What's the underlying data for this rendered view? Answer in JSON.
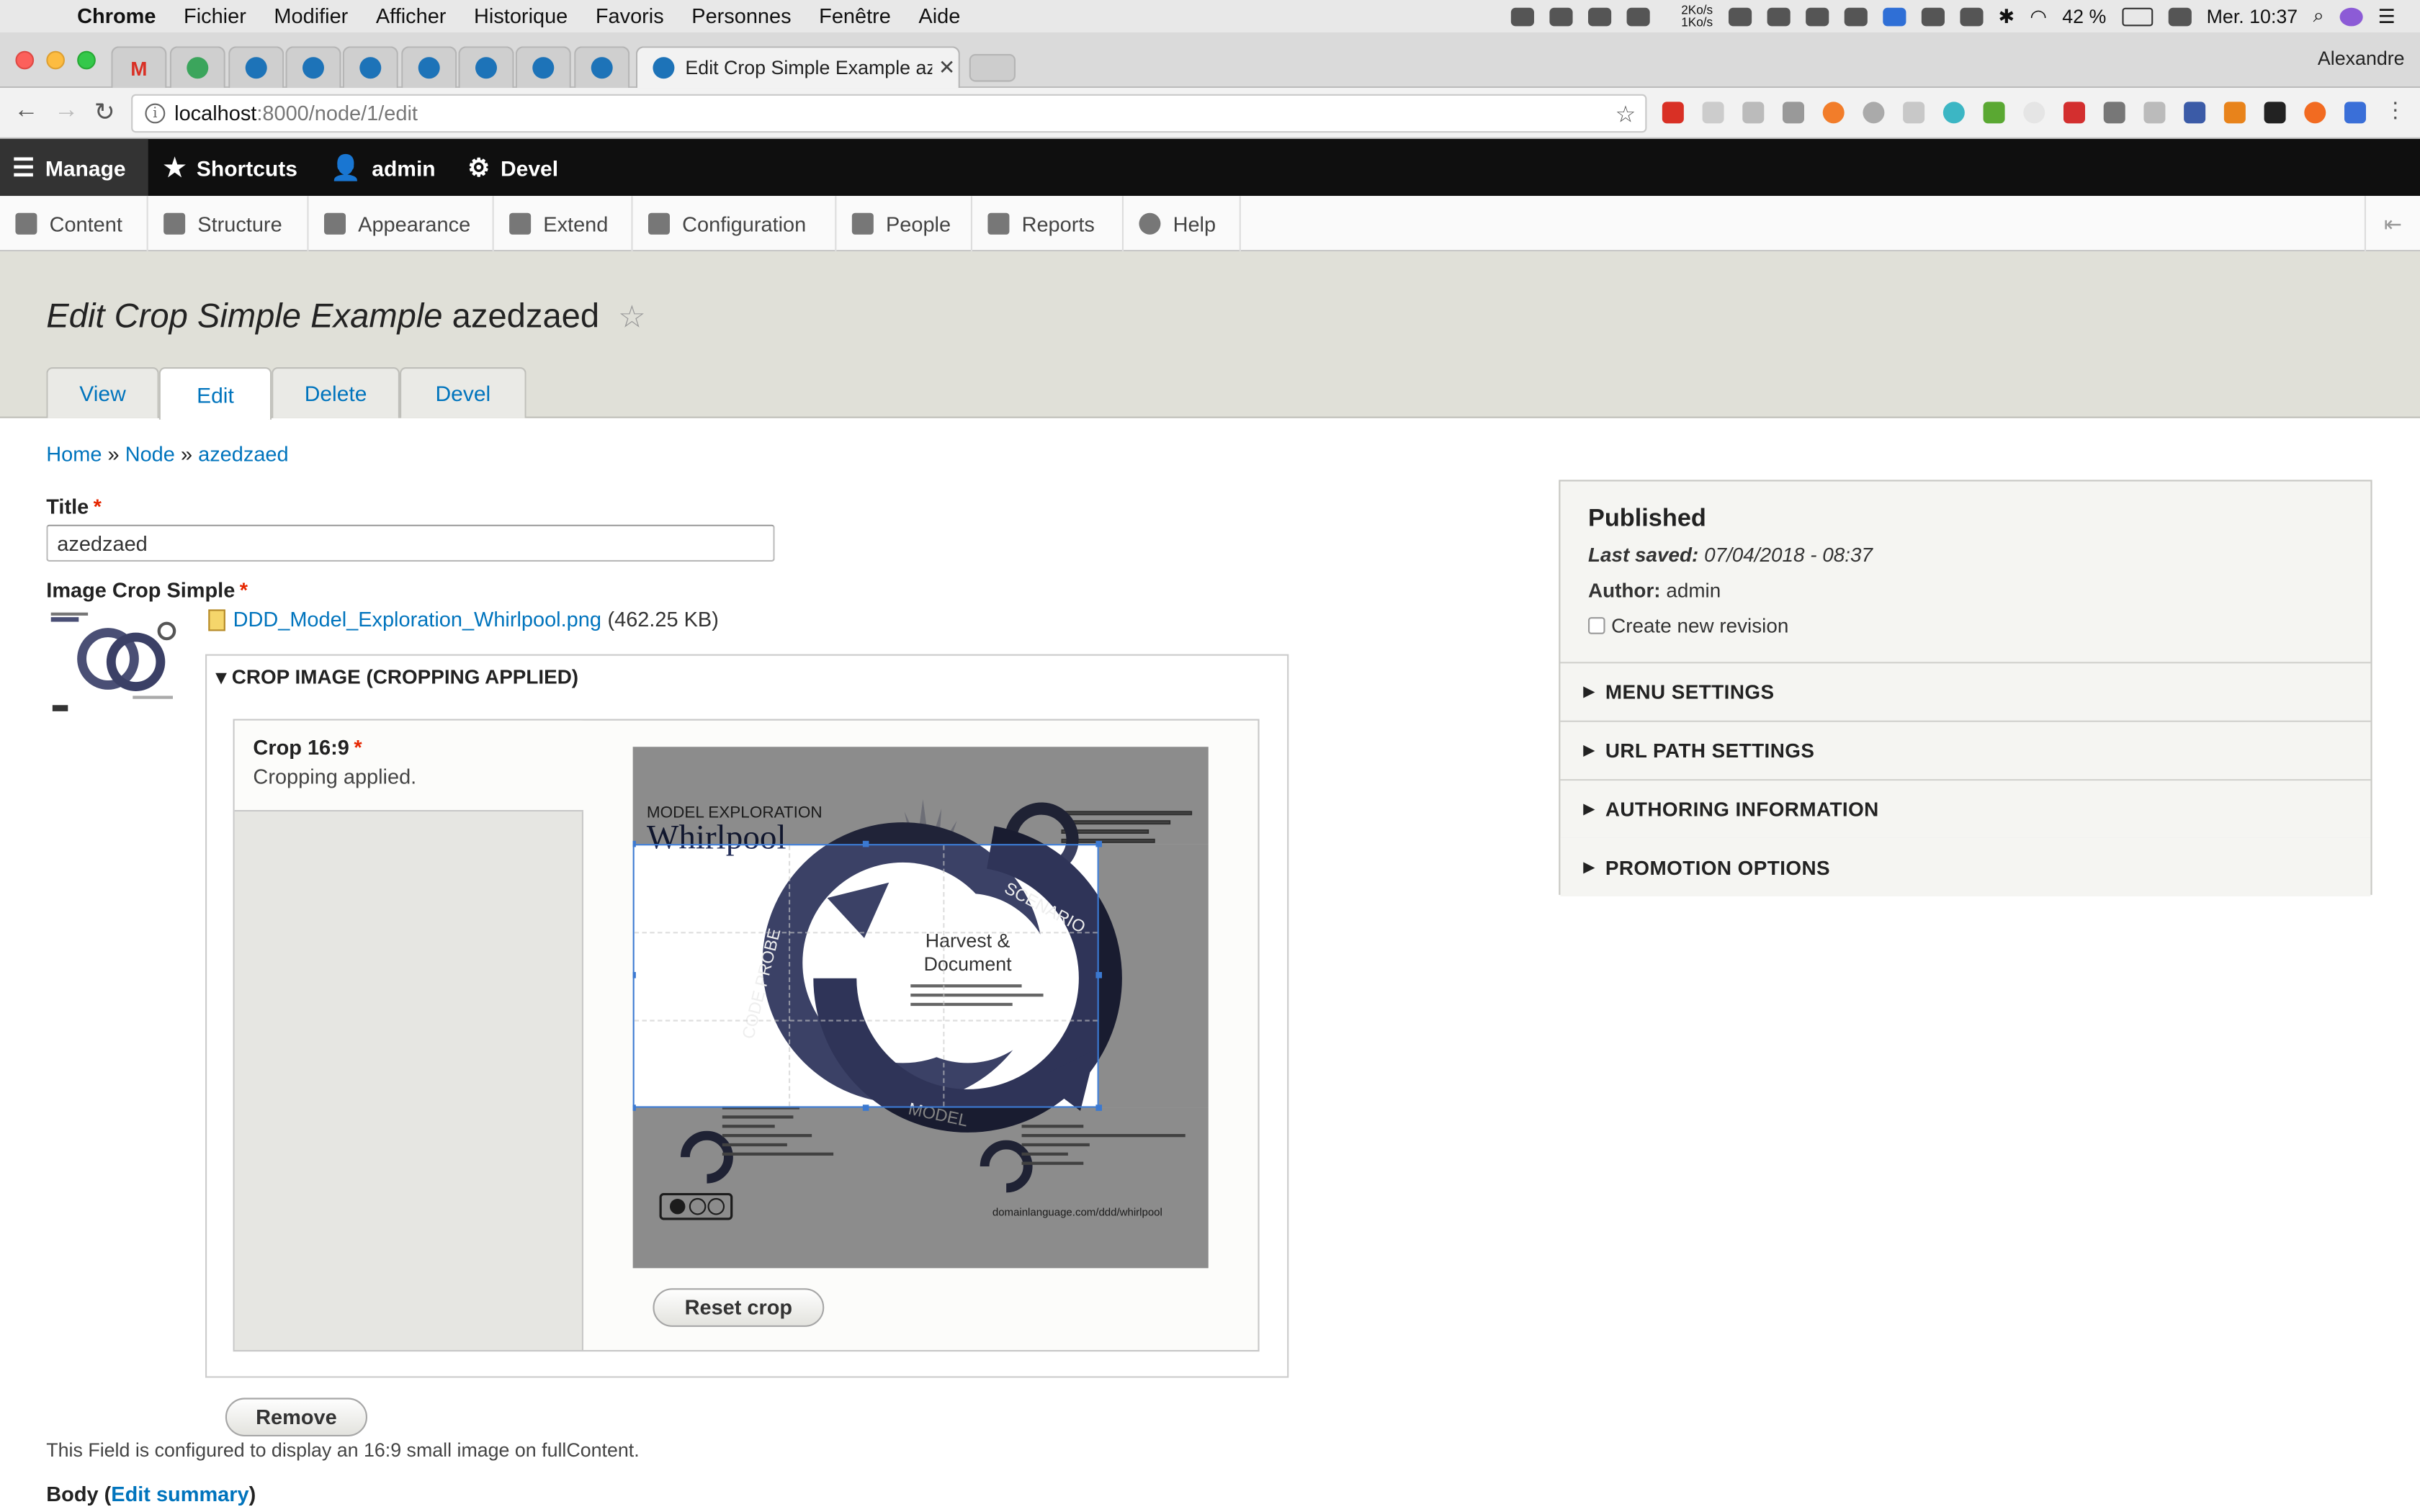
{
  "os_menubar": {
    "items": [
      "Chrome",
      "Fichier",
      "Modifier",
      "Afficher",
      "Historique",
      "Favoris",
      "Personnes",
      "Fenêtre",
      "Aide"
    ],
    "net_up": "2Ko/s",
    "net_down": "1Ko/s",
    "battery": "42 %",
    "clock": "Mer. 10:37"
  },
  "browser": {
    "active_tab_title": "Edit Crop Simple Example azedzaed",
    "profile_name": "Alexandre",
    "url_host": "localhost",
    "url_rest": ":8000/node/1/edit"
  },
  "toolbar": {
    "manage": "Manage",
    "shortcuts": "Shortcuts",
    "user": "admin",
    "devel": "Devel"
  },
  "tray": {
    "items": [
      "Content",
      "Structure",
      "Appearance",
      "Extend",
      "Configuration",
      "People",
      "Reports",
      "Help"
    ]
  },
  "page": {
    "title_italic": "Edit Crop Simple Example",
    "title_rest": "azedzaed",
    "tabs": [
      "View",
      "Edit",
      "Delete",
      "Devel"
    ],
    "active_tab": "Edit"
  },
  "breadcrumb": [
    "Home",
    "Node",
    "azedzaed"
  ],
  "breadcrumb_sep": "»",
  "form": {
    "title_label": "Title",
    "title_value": "azedzaed",
    "image_label": "Image Crop Simple",
    "file_name": "DDD_Model_Exploration_Whirlpool.png",
    "file_size": "(462.25 KB)",
    "crop_summary": "CROP IMAGE (CROPPING APPLIED)",
    "crop_name": "Crop 16:9",
    "crop_status": "Cropping applied.",
    "reset_label": "Reset crop",
    "remove_label": "Remove",
    "help_text": "This Field is configured to display an 16:9 small image on fullContent.",
    "body_label": "Body",
    "edit_summary": "Edit summary"
  },
  "whirlpool": {
    "heading_small": "MODEL EXPLORATION",
    "heading_big": "Whirlpool",
    "center_line1": "Harvest &",
    "center_line2": "Document",
    "label_scenario": "SCENARIO",
    "label_code": "CODE PROBE",
    "label_model": "MODEL",
    "footer_url": "domainlanguage.com/ddd/whirlpool"
  },
  "sidebar": {
    "status": "Published",
    "last_saved_label": "Last saved:",
    "last_saved": "07/04/2018 - 08:37",
    "author_label": "Author:",
    "author": "admin",
    "revision_label": "Create new revision",
    "sections": [
      "MENU SETTINGS",
      "URL PATH SETTINGS",
      "AUTHORING INFORMATION",
      "PROMOTION OPTIONS"
    ]
  },
  "colors": {
    "link": "#0074bd",
    "toolbar_bg": "#0f0f0f",
    "header_bg": "#e0e0d8",
    "required": "#e62600",
    "crop_frame": "#3b79d1"
  }
}
